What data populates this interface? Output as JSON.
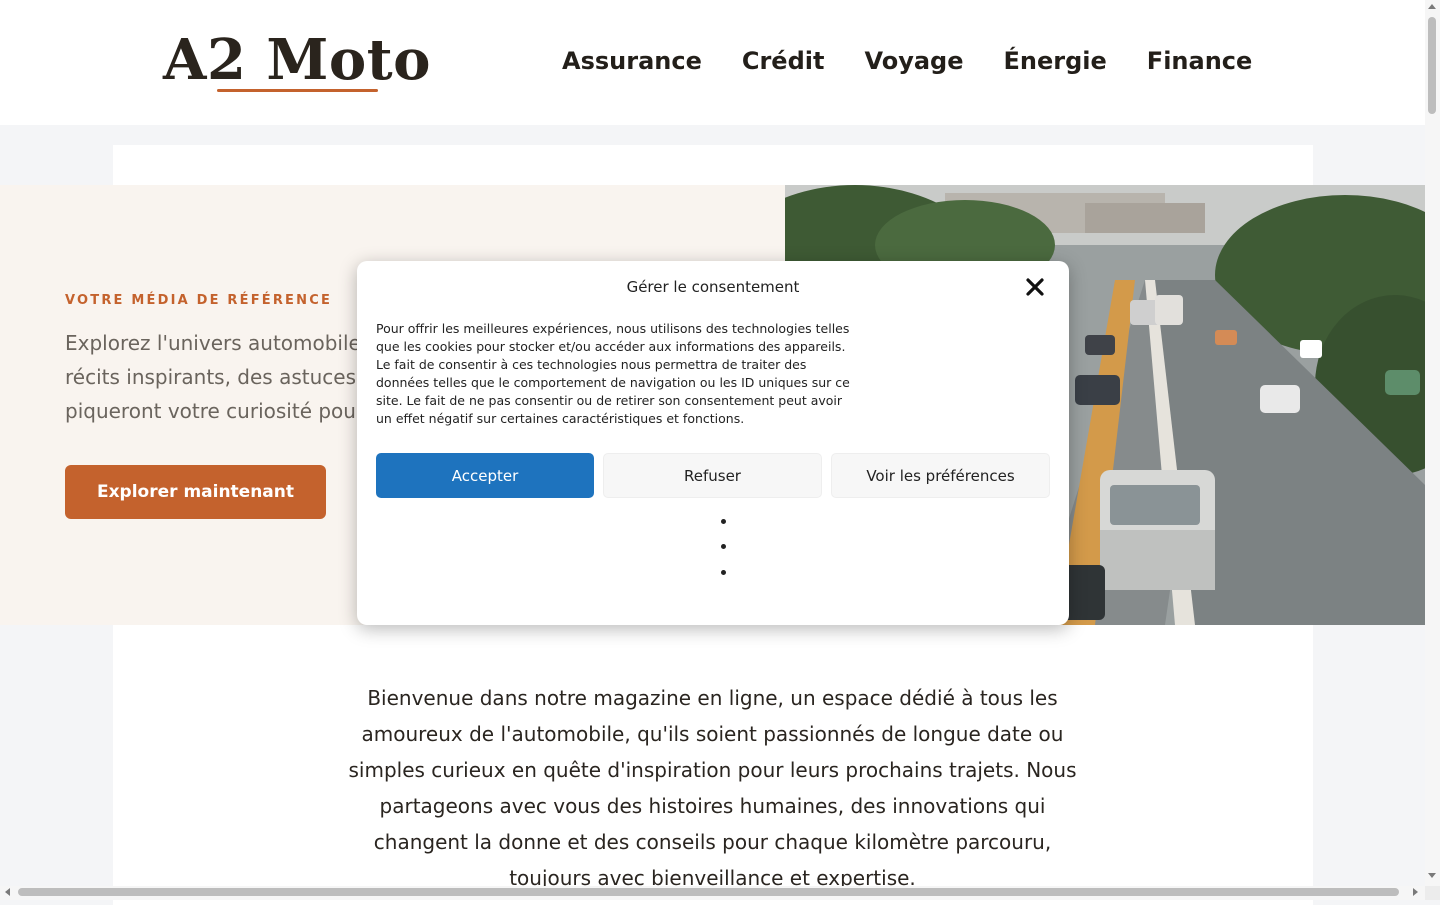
{
  "header": {
    "logo": "A2 Moto",
    "nav": [
      "Assurance",
      "Crédit",
      "Voyage",
      "Énergie",
      "Finance"
    ]
  },
  "hero": {
    "kicker": "VOTRE MÉDIA DE RÉFÉRENCE",
    "text": "Explorez l'univers automobile\nrécits inspirants, des astuces\npiqueront votre curiosité pou",
    "cta": "Explorer maintenant",
    "photo_icon": "city-road-traffic-photo"
  },
  "intro": {
    "text": "Bienvenue dans notre magazine en ligne, un espace dédié à tous les amoureux de l'automobile, qu'ils soient passionnés de longue date ou simples curieux en quête d'inspiration pour leurs prochains trajets. Nous partageons avec vous des histoires humaines, des innovations qui changent la donne et des conseils pour chaque kilomètre parcouru, toujours avec bienveillance et expertise."
  },
  "consent": {
    "title": "Gérer le consentement",
    "close_icon": "close-icon",
    "body": "Pour offrir les meilleures expériences, nous utilisons des technologies telles que les cookies pour stocker et/ou accéder aux informations des appareils. Le fait de consentir à ces technologies nous permettra de traiter des données telles que le comportement de navigation ou les ID uniques sur ce site. Le fait de ne pas consentir ou de retirer son consentement peut avoir un effet négatif sur certaines caractéristiques et fonctions.",
    "accept": "Accepter",
    "refuse": "Refuser",
    "preferences": "Voir les préférences"
  },
  "colors": {
    "accent": "#c4622d",
    "accept_button": "#1e73be",
    "hero_background": "#f9f4ef"
  }
}
